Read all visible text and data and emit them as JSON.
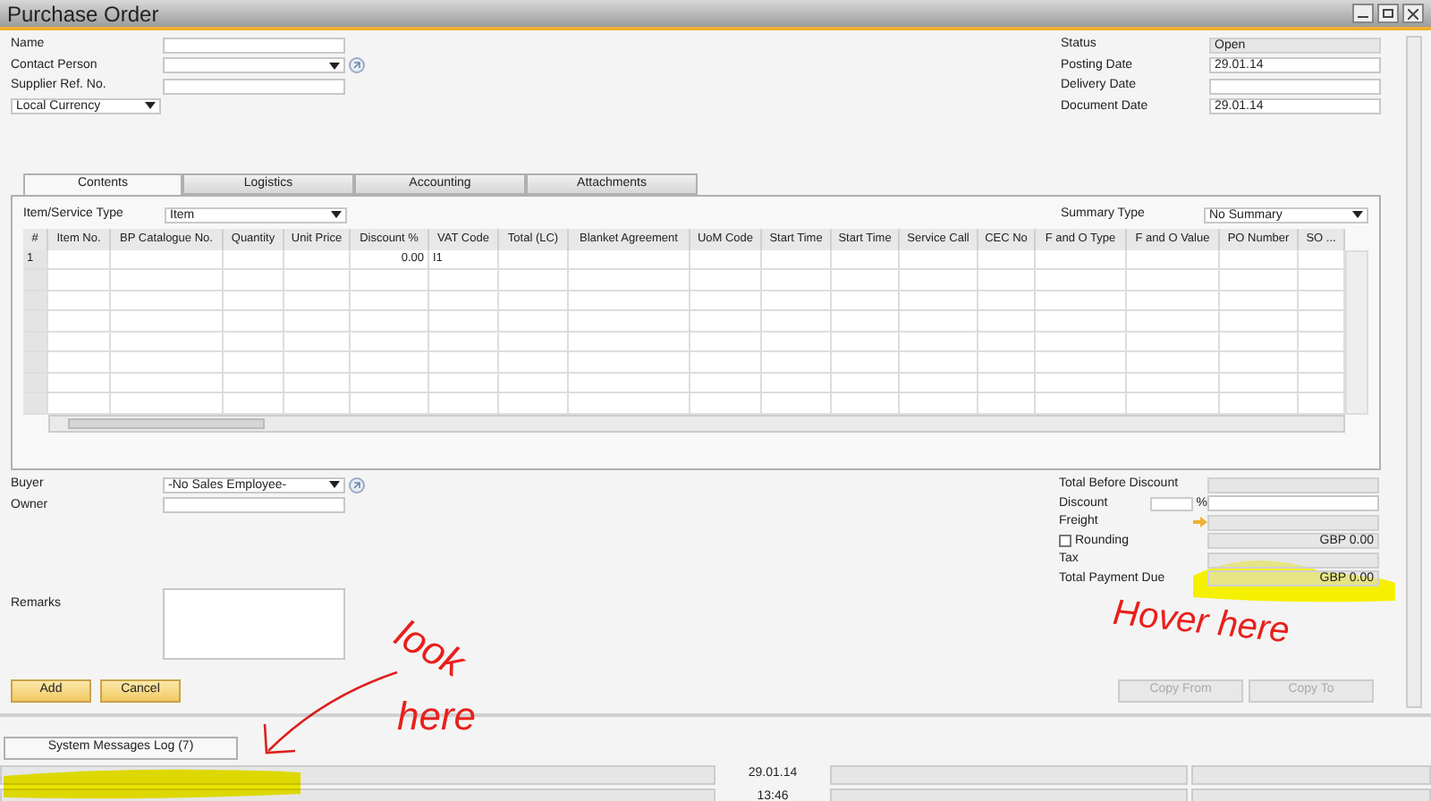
{
  "window": {
    "title": "Purchase Order"
  },
  "header_left": [
    {
      "label": "Name",
      "kind": "text"
    },
    {
      "label": "Contact Person",
      "kind": "dropdown_link"
    },
    {
      "label": "Supplier Ref. No.",
      "kind": "text"
    }
  ],
  "currency": {
    "value": "Local Currency"
  },
  "header_right": [
    {
      "label": "Status",
      "value": "Open",
      "disabled": true
    },
    {
      "label": "Posting Date",
      "value": "29.01.14",
      "disabled": false
    },
    {
      "label": "Delivery Date",
      "disabled": false
    },
    {
      "label": "Document Date",
      "value": "29.01.14",
      "disabled": false
    }
  ],
  "tabs": [
    {
      "label": "Contents",
      "selected": true
    },
    {
      "label": "Logistics",
      "selected": false
    },
    {
      "label": "Accounting",
      "selected": false
    },
    {
      "label": "Attachments",
      "selected": false
    }
  ],
  "item_type": {
    "label": "Item/Service Type",
    "value": "Item"
  },
  "summary_type": {
    "label": "Summary Type",
    "value": "No Summary"
  },
  "table": {
    "columns": [
      "#",
      "Item No.",
      "BP Catalogue No.",
      "Quantity",
      "Unit Price",
      "Discount %",
      "VAT Code",
      "Total (LC)",
      "Blanket Agreement",
      "UoM Code",
      "Start Time",
      "Start Time",
      "Service Call",
      "CEC No",
      "F and O Type",
      "F and O Value",
      "PO Number",
      "SO ..."
    ],
    "rows": [
      {
        "cells": [
          "1",
          null,
          null,
          null,
          null,
          "0.00",
          "I1",
          null,
          null,
          null,
          null,
          null,
          null,
          null,
          null,
          null,
          null,
          null
        ]
      }
    ]
  },
  "buyer": {
    "label": "Buyer",
    "value": "-No Sales Employee-"
  },
  "owner": {
    "label": "Owner"
  },
  "remarks": {
    "label": "Remarks"
  },
  "totals": [
    {
      "label": "Total Before Discount",
      "kind": "plain",
      "disabled": true
    },
    {
      "label": "Discount",
      "kind": "discount",
      "unit": "%",
      "disabled": false
    },
    {
      "label": "Freight",
      "kind": "freight",
      "disabled": true
    },
    {
      "label": "Rounding",
      "kind": "rounding",
      "checked": false,
      "value": "GBP 0.00",
      "disabled": true
    },
    {
      "label": "Tax",
      "kind": "plain",
      "disabled": true
    },
    {
      "label": "Total Payment Due",
      "kind": "plain",
      "value": "GBP 0.00",
      "disabled": true
    }
  ],
  "actions": [
    {
      "label": "Add",
      "disabled": false
    },
    {
      "label": "Cancel",
      "disabled": false
    }
  ],
  "copy_actions": [
    {
      "label": "Copy From",
      "disabled": true
    },
    {
      "label": "Copy To",
      "disabled": true
    }
  ],
  "messages_tab": {
    "label": "System Messages Log (7)"
  },
  "status_bar": {
    "date": "29.01.14",
    "time": "13:46"
  },
  "annotations": [
    {
      "text": "look"
    },
    {
      "text": "here"
    },
    {
      "text": "Hover here"
    }
  ]
}
